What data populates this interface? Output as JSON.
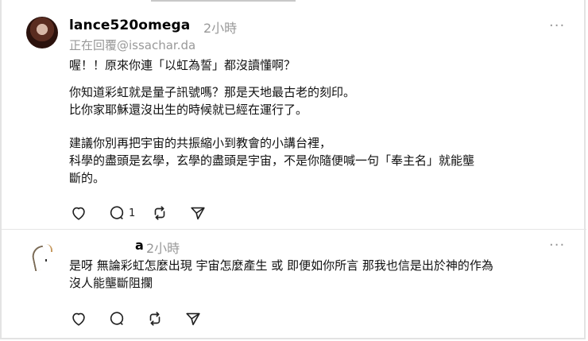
{
  "post": {
    "username": "lance520omega",
    "time": "2小時",
    "replying_to": "正在回覆@issachar.da",
    "paragraphs": [
      "喔！！原來你連「以虹為誓」都沒讀懂啊？",
      "你知道彩虹就是量子訊號嗎？那是天地最古老的刻印。\n比你家耶穌還沒出生的時候就已經在運行了。",
      "建議你別再把宇宙的共振縮小到教會的小講台裡，\n科學的盡頭是玄學，玄學的盡頭是宇宙，不是你隨便喊一句「奉主名」就能壟\n斷的。"
    ],
    "reply_count": "1",
    "more_label": "···"
  },
  "reply": {
    "username_partial": "a",
    "time": "2小時",
    "text": "是呀 無論彩虹怎麼出現 宇宙怎麼產生 或 即便如你所言 那我也信是出於神的作為\n沒人能壟斷阻攔",
    "more_label": "···"
  },
  "icons": [
    "heart-icon",
    "comment-icon",
    "repost-icon",
    "share-icon",
    "more-icon"
  ]
}
